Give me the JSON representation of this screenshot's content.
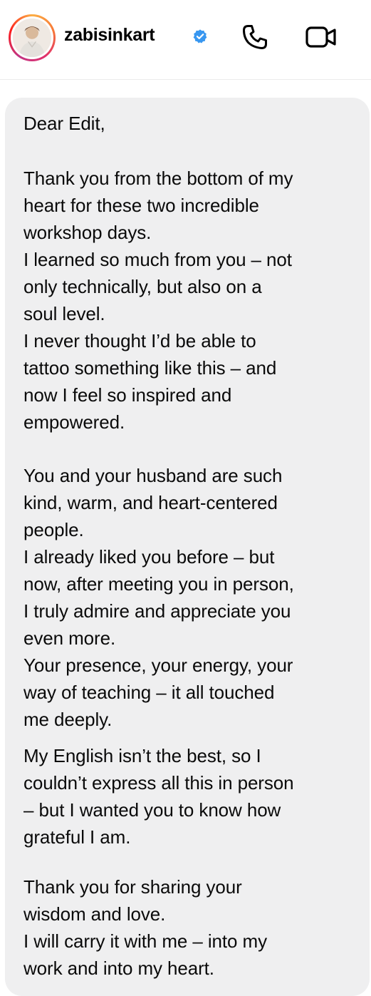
{
  "header": {
    "username": "zabisinkart",
    "verified": true,
    "icons": {
      "avatar": "profile-photo",
      "verified": "verified-badge-icon",
      "call": "phone-icon",
      "video": "video-camera-icon"
    },
    "colors": {
      "verified_blue": "#3897f0",
      "story_ring": [
        "#fcaf45",
        "#e1306c",
        "#c13584"
      ]
    }
  },
  "message": {
    "bubble_color": "#efeff0",
    "lines": [
      "Dear Edit,",
      "Thank you from the bottom of my",
      "heart for these two incredible",
      "workshop days.",
      "I learned so much from you – not",
      "only technically, but also on a",
      "soul level.",
      "I never thought I’d be able to",
      "tattoo something like this – and",
      "now I feel so inspired and",
      "empowered.",
      "You and your husband are such",
      "kind, warm, and heart-centered",
      "people.",
      "I already liked you before – but",
      "now, after meeting you in person,",
      "I truly admire and appreciate you",
      "even more.",
      "Your presence, your energy, your",
      "way of teaching – it all touched",
      "me deeply.",
      "My English isn’t the best, so I",
      "couldn’t express all this in person",
      "– but I wanted you to know how",
      "grateful I am.",
      "Thank you for sharing your",
      "wisdom and love.",
      "I will carry it with me – into my",
      "work and into my heart."
    ]
  }
}
